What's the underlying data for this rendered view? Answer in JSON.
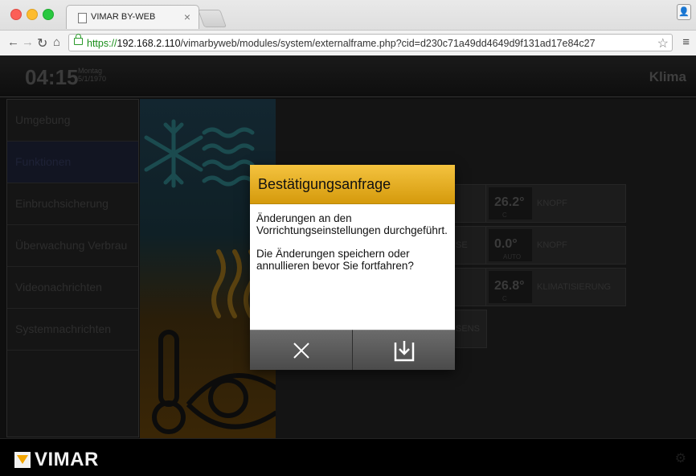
{
  "browser": {
    "tab_title": "VIMAR BY-WEB",
    "tab_close": "×",
    "url_scheme": "https://",
    "url_host": "192.168.2.110",
    "url_path": "/vimarbyweb/modules/system/externalframe.php?cid=d230c71a49dd4649d9f131ad17e84c27"
  },
  "header": {
    "time": "04:15",
    "day": "Montag",
    "date": "5/1/1970",
    "title": "Klima"
  },
  "sidebar": {
    "items": [
      {
        "label": "Umgebung"
      },
      {
        "label": "Funktionen"
      },
      {
        "label": "Einbruchsicherung"
      },
      {
        "label": "Überwachung Verbrau"
      },
      {
        "label": "Videonachrichten"
      },
      {
        "label": "Systemnachrichten"
      }
    ]
  },
  "tiles": [
    {
      "value": "26.2°",
      "sub": "C",
      "label": "KNOPF"
    },
    {
      "value": "0.0°",
      "sub": "AUTO",
      "label": "KNOPF"
    },
    {
      "value": "26.8°",
      "sub": "C",
      "label": "KLIMATISIERUNG"
    }
  ],
  "partial_labels": {
    "se": "SE",
    "sens": "SENS"
  },
  "dialog": {
    "title": "Bestätigungsanfrage",
    "line1": "Änderungen an den Vorrichtungseinstellungen durchgeführt.",
    "line2": "Die Änderungen speichern oder annullieren bevor Sie fortfahren?"
  },
  "footer": {
    "brand": "VIMAR"
  },
  "colors": {
    "dialog_header": "#e8b224",
    "logo_orange": "#f2a500"
  }
}
